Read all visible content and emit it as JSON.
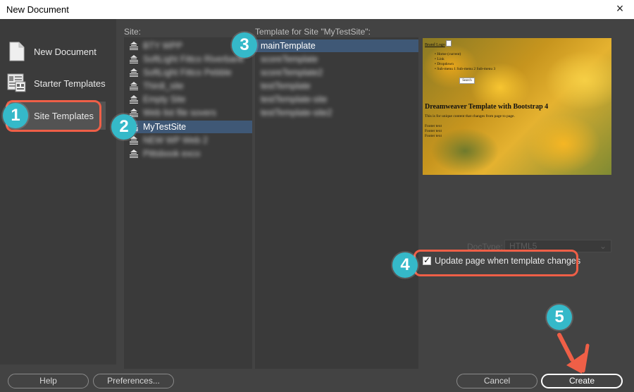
{
  "window": {
    "title": "New Document",
    "close_icon": "×"
  },
  "categories": [
    {
      "label": "New Document",
      "icon": "document-icon"
    },
    {
      "label": "Starter Templates",
      "icon": "starter-templates-icon"
    },
    {
      "label": "Site Templates",
      "icon": "site-templates-icon",
      "selected": true
    }
  ],
  "sites": {
    "label": "Site:",
    "items": [
      "BTY WPP",
      "SoftLight Fittco Riverbank",
      "SoftLight Fittco Pebble",
      "Thirdi_site",
      "Empty Site",
      "Web list file sovers",
      "MyTestSite",
      "NEW WP Web 2",
      "Pittsbook exco"
    ],
    "selected": "MyTestSite"
  },
  "templates": {
    "label": "Template for Site \"MyTestSite\":",
    "items": [
      "mainTemplate",
      "scoreTemplate",
      "scoreTemplate2",
      "testTemplate",
      "testTemplate-site",
      "testTemplate-site2"
    ],
    "selected": "mainTemplate"
  },
  "preview": {
    "brand": "Brand Logo",
    "nav": [
      "Home (current)",
      "Link",
      "Dropdown",
      "Sub-menu 1 Sub-menu 2 Sub-menu 3"
    ],
    "search_button": "Search",
    "heading": "Dreamweaver Template with Bootstrap 4",
    "paragraph": "This is for unique content that changes from page to page.",
    "footer": [
      "Footer text",
      "Footer text",
      "Footer text"
    ]
  },
  "doctype": {
    "label": "DocType:",
    "value": "HTML5"
  },
  "update_checkbox": {
    "label": "Update page when template changes",
    "checked": true
  },
  "buttons": {
    "help": "Help",
    "preferences": "Preferences...",
    "cancel": "Cancel",
    "create": "Create"
  },
  "callouts": [
    "1",
    "2",
    "3",
    "4",
    "5"
  ],
  "colors": {
    "highlight": "#ef5f47",
    "badge": "#35b9c9",
    "selection": "#3f5876"
  }
}
